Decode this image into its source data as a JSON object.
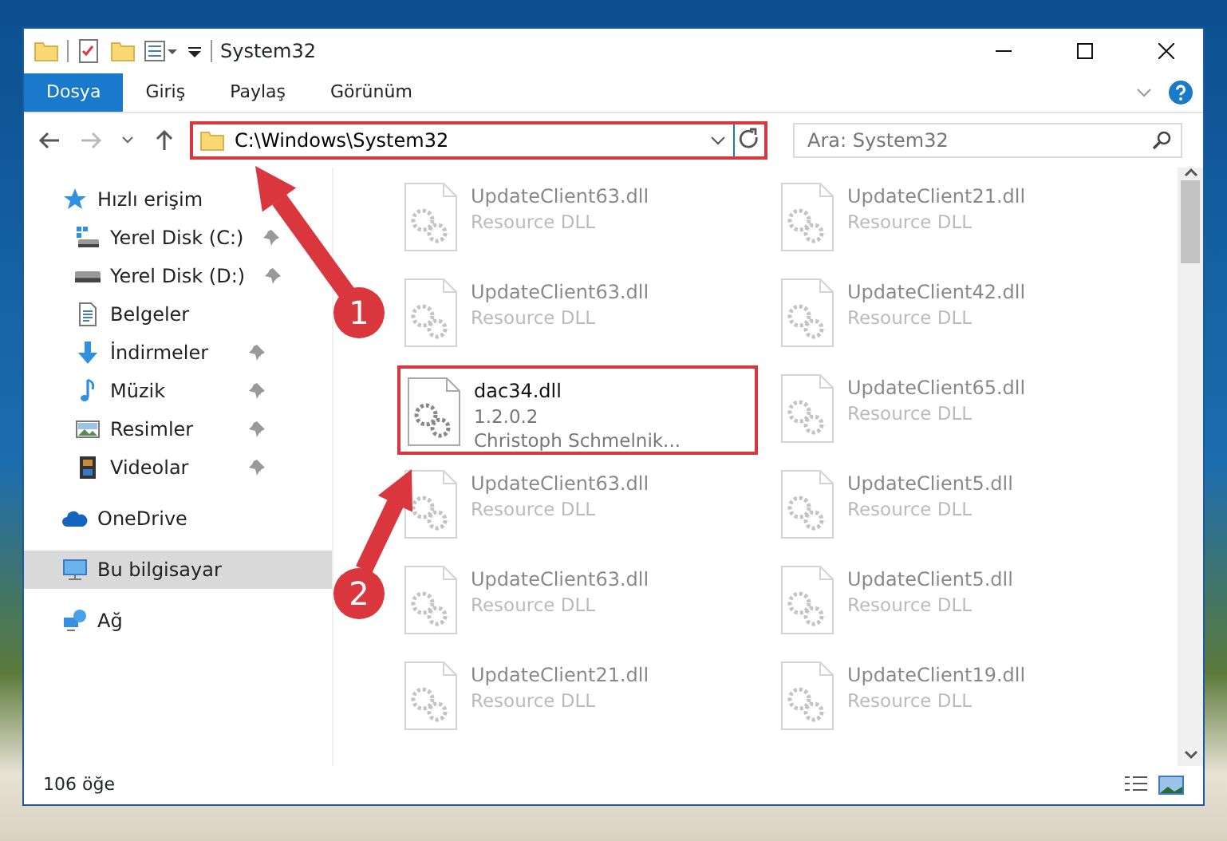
{
  "window": {
    "title": "System32"
  },
  "ribbon_tabs": [
    {
      "label": "Dosya",
      "selected": true
    },
    {
      "label": "Giriş",
      "selected": false
    },
    {
      "label": "Paylaş",
      "selected": false
    },
    {
      "label": "Görünüm",
      "selected": false
    }
  ],
  "address": {
    "path": "C:\\Windows\\System32",
    "highlighted": true
  },
  "search": {
    "placeholder": "Ara: System32"
  },
  "sidebar": {
    "items": [
      {
        "label": "Hızlı erişim",
        "kind": "star",
        "selected": false,
        "children": [
          {
            "label": "Yerel Disk (C:)",
            "kind": "drive-windows",
            "pinned": true,
            "selected": false
          },
          {
            "label": "Yerel Disk (D:)",
            "kind": "drive",
            "pinned": true,
            "selected": false
          },
          {
            "label": "Belgeler",
            "kind": "document",
            "pinned": false,
            "selected": false
          },
          {
            "label": "İndirmeler",
            "kind": "download",
            "pinned": true,
            "selected": false
          },
          {
            "label": "Müzik",
            "kind": "music",
            "pinned": true,
            "selected": false
          },
          {
            "label": "Resimler",
            "kind": "picture",
            "pinned": true,
            "selected": false
          },
          {
            "label": "Videolar",
            "kind": "video",
            "pinned": true,
            "selected": false
          }
        ]
      },
      {
        "label": "OneDrive",
        "kind": "cloud",
        "selected": false
      },
      {
        "label": "Bu bilgisayar",
        "kind": "computer",
        "selected": true
      },
      {
        "label": "Ağ",
        "kind": "network",
        "selected": false
      }
    ]
  },
  "files": [
    {
      "name": "UpdateClient63.dll",
      "details": [
        "Resource DLL"
      ],
      "dimmed": true,
      "highlighted": false
    },
    {
      "name": "UpdateClient21.dll",
      "details": [
        "Resource DLL"
      ],
      "dimmed": true,
      "highlighted": false
    },
    {
      "name": "UpdateClient63.dll",
      "details": [
        "Resource DLL"
      ],
      "dimmed": true,
      "highlighted": false
    },
    {
      "name": "UpdateClient42.dll",
      "details": [
        "Resource DLL"
      ],
      "dimmed": true,
      "highlighted": false
    },
    {
      "name": "dac34.dll",
      "details": [
        "1.2.0.2",
        "Christoph Schmelnik..."
      ],
      "dimmed": false,
      "highlighted": true
    },
    {
      "name": "UpdateClient65.dll",
      "details": [
        "Resource DLL"
      ],
      "dimmed": true,
      "highlighted": false
    },
    {
      "name": "UpdateClient63.dll",
      "details": [
        "Resource DLL"
      ],
      "dimmed": true,
      "highlighted": false
    },
    {
      "name": "UpdateClient5.dll",
      "details": [
        "Resource DLL"
      ],
      "dimmed": true,
      "highlighted": false
    },
    {
      "name": "UpdateClient63.dll",
      "details": [
        "Resource DLL"
      ],
      "dimmed": true,
      "highlighted": false
    },
    {
      "name": "UpdateClient5.dll",
      "details": [
        "Resource DLL"
      ],
      "dimmed": true,
      "highlighted": false
    },
    {
      "name": "UpdateClient21.dll",
      "details": [
        "Resource DLL"
      ],
      "dimmed": true,
      "highlighted": false
    },
    {
      "name": "UpdateClient19.dll",
      "details": [
        "Resource DLL"
      ],
      "dimmed": true,
      "highlighted": false
    }
  ],
  "status_bar": {
    "item_count": "106 öğe"
  },
  "annotations": [
    {
      "label": "1"
    },
    {
      "label": "2"
    }
  ]
}
